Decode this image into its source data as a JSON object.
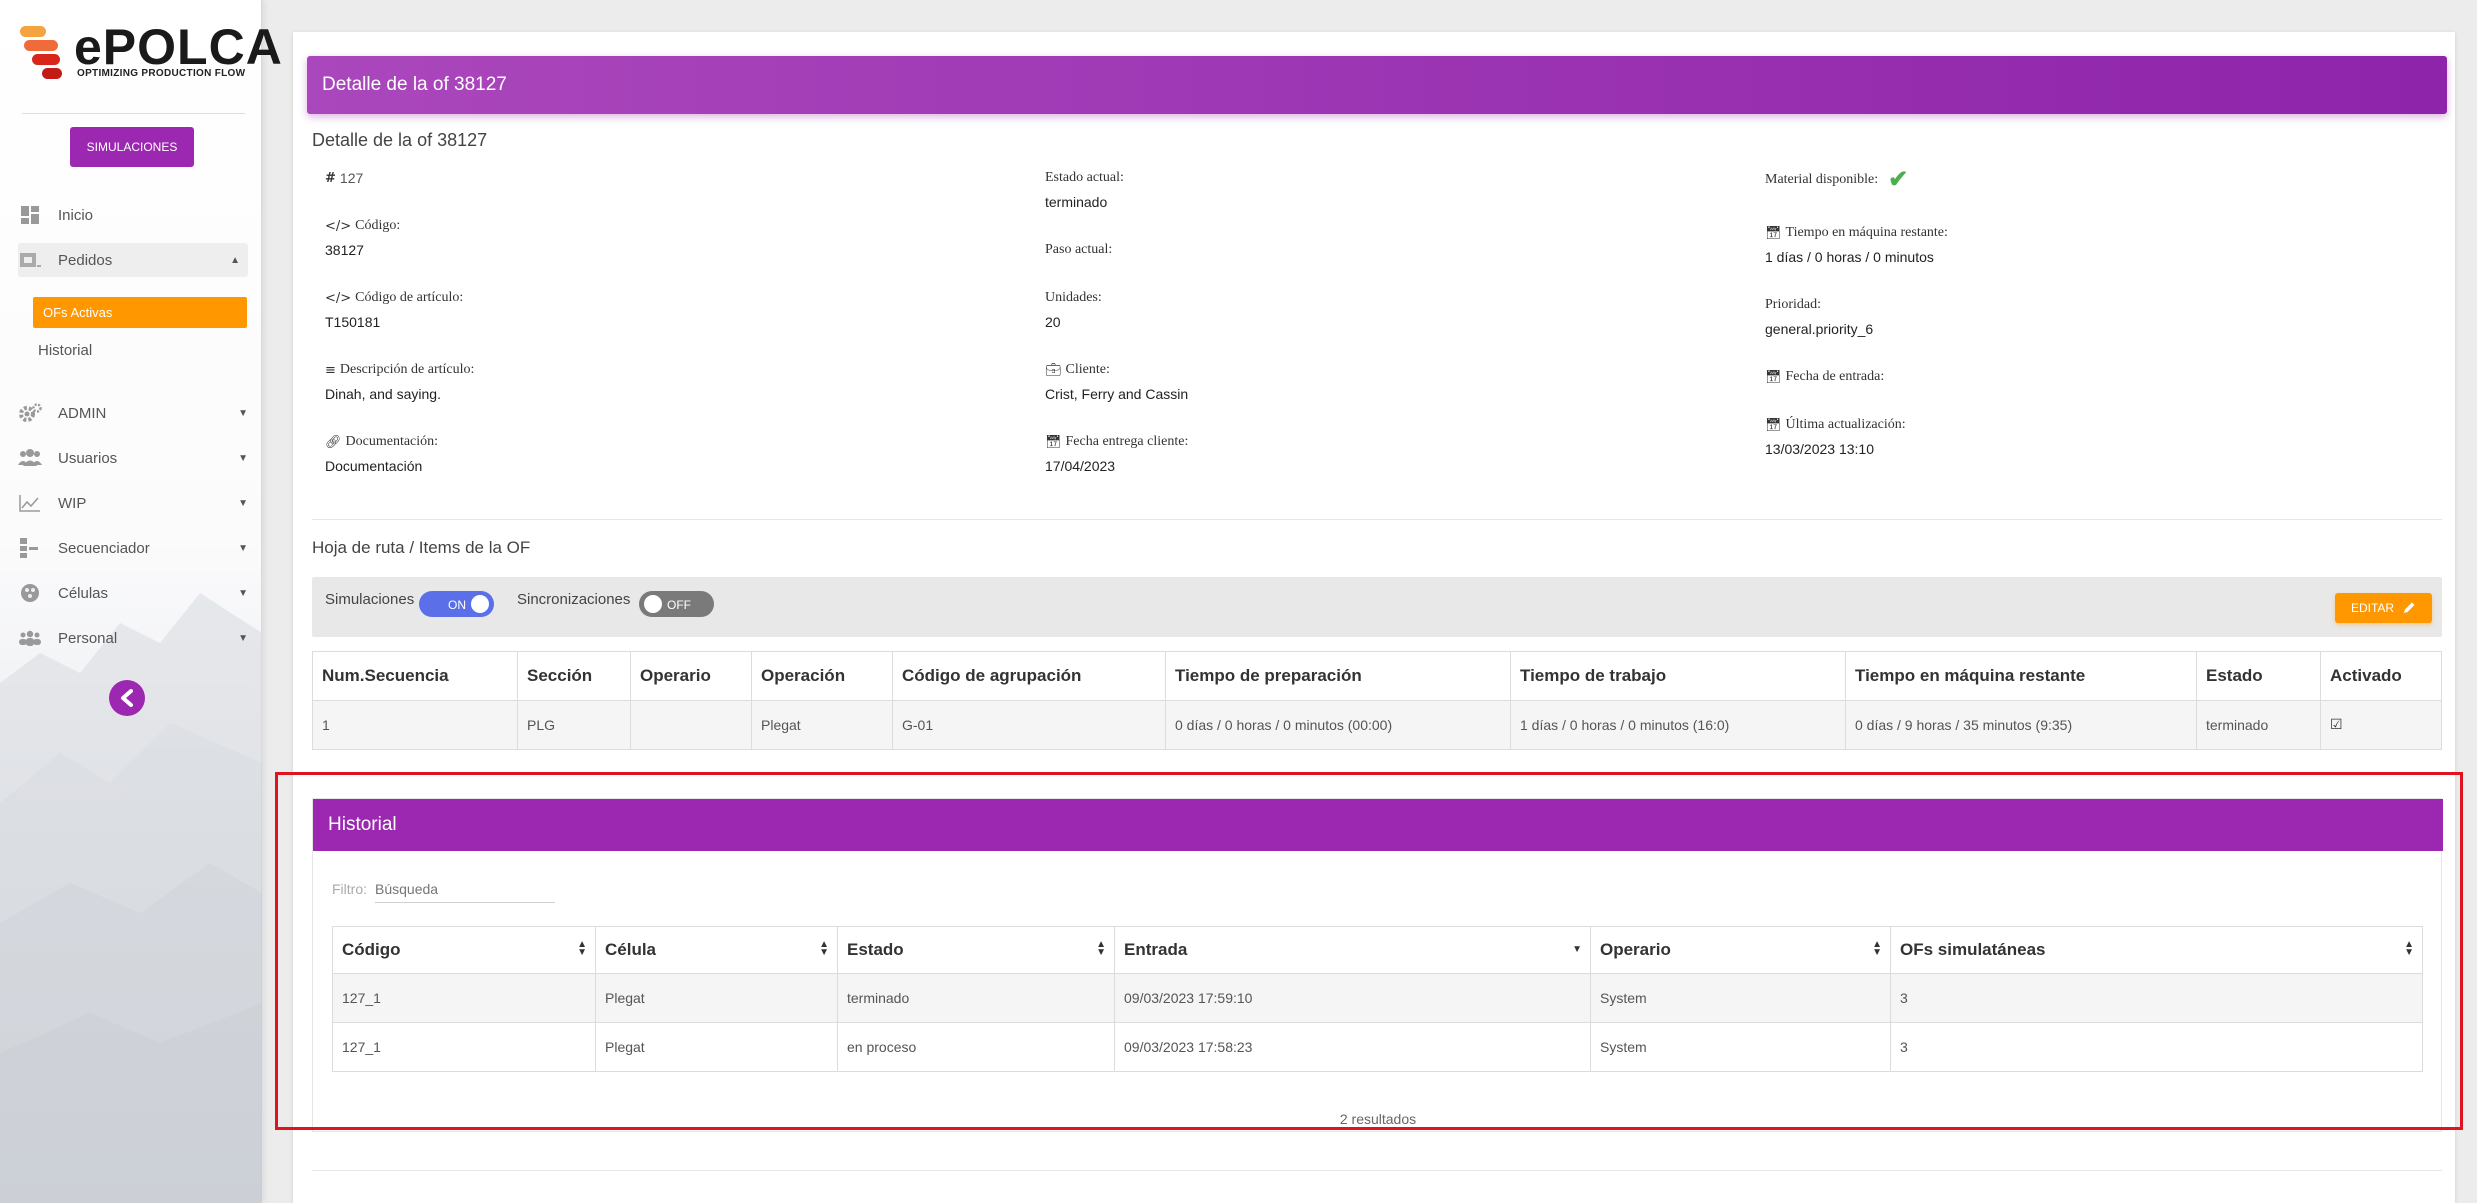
{
  "brand": {
    "name": "ePOLCA",
    "tagline": "OPTIMIZING PRODUCTION FLOW",
    "accent": "#9c27b0",
    "orange": "#ff9800"
  },
  "sidebar": {
    "simulations_button": "SIMULACIONES",
    "items": [
      {
        "label": "Inicio",
        "icon": "dashboard-icon"
      },
      {
        "label": "Pedidos",
        "icon": "orders-icon"
      },
      {
        "label": "ADMIN",
        "icon": "gear-icon"
      },
      {
        "label": "Usuarios",
        "icon": "users-icon"
      },
      {
        "label": "WIP",
        "icon": "chart-line-icon"
      },
      {
        "label": "Secuenciador",
        "icon": "sequencer-icon"
      },
      {
        "label": "Células",
        "icon": "cells-icon"
      },
      {
        "label": "Personal",
        "icon": "people-icon"
      }
    ],
    "sub_items": {
      "active": "OFs Activas",
      "history": "Historial"
    }
  },
  "header": {
    "title": "Detalle de la of 38127"
  },
  "details": {
    "section_title": "Detalle de la of 38127",
    "id": "127",
    "codigo": {
      "label": "Código:",
      "value": "38127"
    },
    "codigo_articulo": {
      "label": "Código de artículo:",
      "value": "T150181"
    },
    "descripcion": {
      "label": "Descripción de artículo:",
      "value": "Dinah, and saying."
    },
    "documentacion": {
      "label": "Documentación:",
      "value": "Documentación"
    },
    "estado_actual": {
      "label": "Estado actual:",
      "value": "terminado"
    },
    "paso_actual": {
      "label": "Paso actual:",
      "value": ""
    },
    "unidades": {
      "label": "Unidades:",
      "value": "20"
    },
    "cliente": {
      "label": "Cliente:",
      "value": "Crist, Ferry and Cassin"
    },
    "fecha_entrega": {
      "label": "Fecha entrega cliente:",
      "value": "17/04/2023"
    },
    "material": {
      "label": "Material disponible:",
      "value": true
    },
    "tiempo_restante": {
      "label": "Tiempo en máquina restante:",
      "value": "1 días / 0 horas / 0 minutos"
    },
    "prioridad": {
      "label": "Prioridad:",
      "value": "general.priority_6"
    },
    "fecha_entrada": {
      "label": "Fecha de entrada:",
      "value": ""
    },
    "ultima_actualizacion": {
      "label": "Última actualización:",
      "value": "13/03/2023 13:10"
    }
  },
  "route": {
    "section_title": "Hoja de ruta / Items de la OF",
    "toggles": {
      "simulaciones": {
        "label": "Simulaciones",
        "state": "ON"
      },
      "sincronizaciones": {
        "label": "Sincronizaciones",
        "state": "OFF"
      }
    },
    "edit_button": "EDITAR",
    "columns": [
      "Num.Secuencia",
      "Sección",
      "Operario",
      "Operación",
      "Código de agrupación",
      "Tiempo de preparación",
      "Tiempo de trabajo",
      "Tiempo en máquina restante",
      "Estado",
      "Activado"
    ],
    "rows": [
      [
        "1",
        "PLG",
        "",
        "Plegat",
        "G-01",
        "0 días / 0 horas / 0 minutos (00:00)",
        "1 días / 0 horas / 0 minutos (16:0)",
        "0 días / 9 horas / 35 minutos (9:35)",
        "terminado",
        "☑"
      ]
    ]
  },
  "historial": {
    "title": "Historial",
    "filter_label": "Filtro:",
    "filter_placeholder": "Búsqueda",
    "columns": [
      "Código",
      "Célula",
      "Estado",
      "Entrada",
      "Operario",
      "OFs simulatáneas"
    ],
    "rows": [
      [
        "127_1",
        "Plegat",
        "terminado",
        "09/03/2023 17:59:10",
        "System",
        "3"
      ],
      [
        "127_1",
        "Plegat",
        "en proceso",
        "09/03/2023 17:58:23",
        "System",
        "3"
      ]
    ],
    "results": "2 resultados"
  }
}
